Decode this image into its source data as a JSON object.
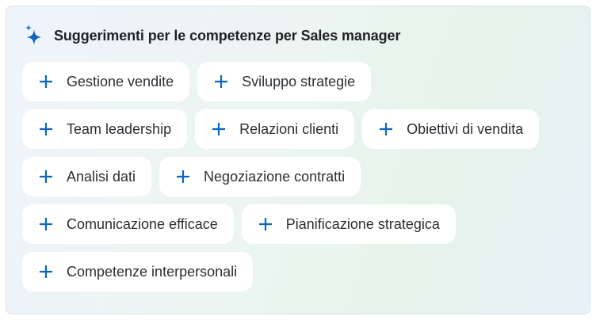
{
  "header": {
    "icon": "sparkle-icon",
    "title": "Suggerimenti per le competenze per Sales manager"
  },
  "colors": {
    "accent": "#0a66c2",
    "title_text": "#1d2226",
    "chip_text": "#2b2f33",
    "chip_bg": "#ffffff"
  },
  "chip_icon": "plus-icon",
  "skills": [
    [
      "Gestione vendite",
      "Sviluppo strategie"
    ],
    [
      "Team leadership",
      "Relazioni clienti",
      "Obiettivi di vendita"
    ],
    [
      "Analisi dati",
      "Negoziazione contratti"
    ],
    [
      "Comunicazione efficace",
      "Pianificazione strategica"
    ],
    [
      "Competenze interpersonali"
    ]
  ]
}
